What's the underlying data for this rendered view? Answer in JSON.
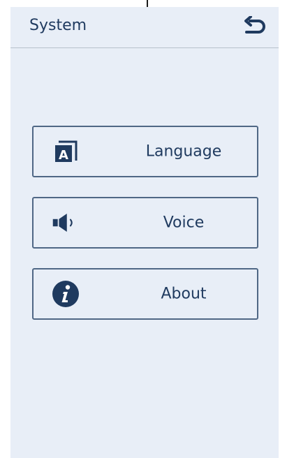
{
  "header": {
    "title": "System",
    "back_icon": "back-arrow-icon"
  },
  "menu": {
    "items": [
      {
        "label": "Language",
        "icon": "language-icon"
      },
      {
        "label": "Voice",
        "icon": "speaker-icon"
      },
      {
        "label": "About",
        "icon": "info-icon"
      }
    ]
  },
  "colors": {
    "background": "#e8eef7",
    "primary": "#1f3a5f",
    "border": "#4f6785"
  }
}
